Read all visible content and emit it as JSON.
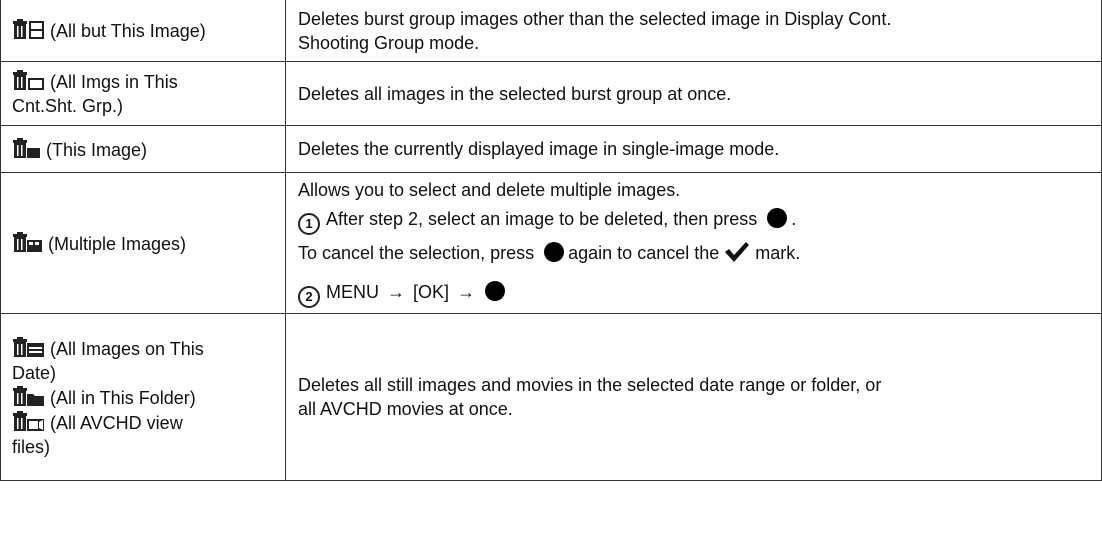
{
  "rows": [
    {
      "options": [
        {
          "icon": "delete-all-but-this-icon",
          "label": "(All but This Image)"
        }
      ],
      "description_lines": [
        "Deletes burst group images other than the selected image in Display Cont.",
        "Shooting Group mode."
      ]
    },
    {
      "options": [
        {
          "icon": "delete-burst-group-icon",
          "label": "(All Imgs in This",
          "label2": "Cnt.Sht. Grp.)"
        }
      ],
      "description": "Deletes all images in the selected burst group at once."
    },
    {
      "options": [
        {
          "icon": "delete-this-image-icon",
          "label": "(This Image)"
        }
      ],
      "description": "Deletes the currently displayed image in single-image mode."
    },
    {
      "options": [
        {
          "icon": "delete-multiple-icon",
          "label": "(Multiple Images)"
        }
      ],
      "multi": {
        "intro": "Allows you to select and delete multiple images.",
        "step1_num": "1",
        "step1_text": "After step 2, select an image to be deleted, then press",
        "step1_end": ".",
        "cancel_pre": "To cancel the selection, press",
        "cancel_mid": "again to cancel the",
        "cancel_post": "mark.",
        "step2_num": "2",
        "step2_menu": "MENU",
        "step2_ok": "[OK]",
        "arrow": "→"
      }
    },
    {
      "options": [
        {
          "icon": "delete-date-icon",
          "label": "(All Images on This",
          "label2": "Date)"
        },
        {
          "icon": "delete-folder-icon",
          "label": "(All in This Folder)"
        },
        {
          "icon": "delete-avchd-icon",
          "label": "(All AVCHD view",
          "label2": "files)"
        }
      ],
      "description_lines": [
        "Deletes all still images and movies in the selected date range or folder, or",
        "all AVCHD movies at once."
      ]
    }
  ]
}
